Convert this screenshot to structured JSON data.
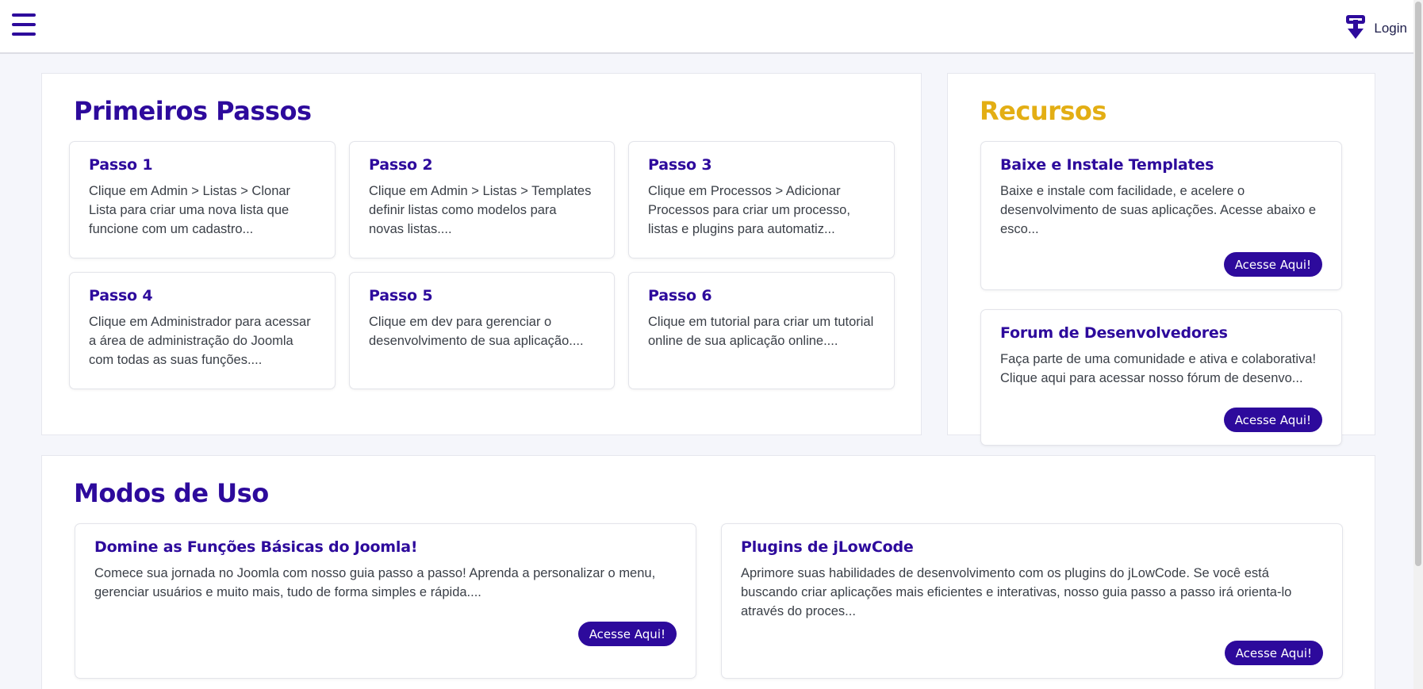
{
  "header": {
    "menu_icon": "hamburger-menu-icon",
    "login_icon": "login-arrow-icon",
    "login_label": "Login"
  },
  "colors": {
    "brand": "#2d0a9c",
    "accent_gold": "#e3ae14"
  },
  "primeiros_passos": {
    "title": "Primeiros Passos",
    "cards": [
      {
        "title": "Passo 1",
        "text": "Clique em Admin > Listas > Clonar Lista para criar uma nova lista que funcione com um cadastro..."
      },
      {
        "title": "Passo 2",
        "text": "Clique em Admin > Listas > Templates definir listas como modelos para novas listas...."
      },
      {
        "title": "Passo 3",
        "text": "Clique em Processos > Adicionar Processos para criar um processo, listas e plugins para automatiz..."
      },
      {
        "title": "Passo 4",
        "text": "Clique em Administrador para acessar a área de administração do Joomla com todas as suas funções...."
      },
      {
        "title": "Passo 5",
        "text": "Clique em dev para gerenciar o desenvolvimento de sua aplicação...."
      },
      {
        "title": "Passo 6",
        "text": "Clique em tutorial para criar um tutorial online de sua aplicação online...."
      }
    ]
  },
  "recursos": {
    "title": "Recursos",
    "cards": [
      {
        "title": "Baixe e Instale Templates",
        "text": "Baixe e instale com facilidade, e acelere o desenvolvimento de suas aplicações. Acesse abaixo e esco...",
        "button": "Acesse Aqui!"
      },
      {
        "title": "Forum de Desenvolvedores",
        "text": "Faça parte de uma comunidade e ativa e colaborativa! Clique aqui para acessar nosso fórum de desenvo...",
        "button": "Acesse Aqui!"
      }
    ]
  },
  "modos_de_uso": {
    "title": "Modos de Uso",
    "cards": [
      {
        "title": "Domine as Funções Básicas do Joomla!",
        "text": "Comece sua jornada no Joomla com nosso guia passo a passo! Aprenda a personalizar o menu, gerenciar usuários e muito mais, tudo de forma simples e rápida....",
        "button": "Acesse Aqui!"
      },
      {
        "title": "Plugins de jLowCode",
        "text": "Aprimore suas habilidades de desenvolvimento com os plugins do jLowCode. Se você está buscando criar aplicações mais eficientes e interativas, nosso guia passo a passo irá orienta-lo através do proces...",
        "button": "Acesse Aqui!"
      }
    ]
  }
}
